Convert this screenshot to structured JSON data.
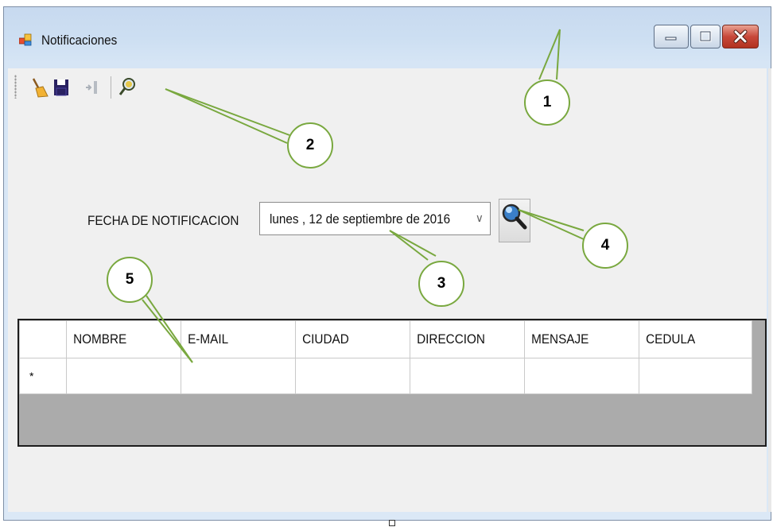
{
  "window": {
    "title": "Notificaciones",
    "icon": "app-form-icon",
    "controls": [
      "minimize-icon",
      "maximize-icon",
      "close-icon"
    ]
  },
  "toolbar": {
    "items": [
      {
        "name": "clear-button",
        "icon": "broom-icon"
      },
      {
        "name": "save-button",
        "icon": "floppy-disk-icon"
      },
      {
        "name": "exit-button",
        "icon": "exit-arrow-icon"
      },
      {
        "name": "search-toolbar-button",
        "icon": "magnifier-icon"
      }
    ]
  },
  "form": {
    "date_label": "FECHA DE NOTIFICACION",
    "date_value": "lunes   , 12 de septiembre de 2016",
    "date_dropdown_glyph": "∨",
    "search_button_icon": "magnifier-icon"
  },
  "grid": {
    "columns": [
      "NOMBRE",
      "E-MAIL",
      "CIUDAD",
      "DIRECCION",
      "MENSAJE",
      "CEDULA"
    ],
    "new_row_marker": "*"
  },
  "callouts": [
    "1",
    "2",
    "3",
    "4",
    "5"
  ],
  "colors": {
    "title_gradient_top": "#c7d9ef",
    "client_bg": "#f0f0f0",
    "grid_bg": "#ababab",
    "callout_border": "#79a83f",
    "close_button": "#c8493a"
  }
}
